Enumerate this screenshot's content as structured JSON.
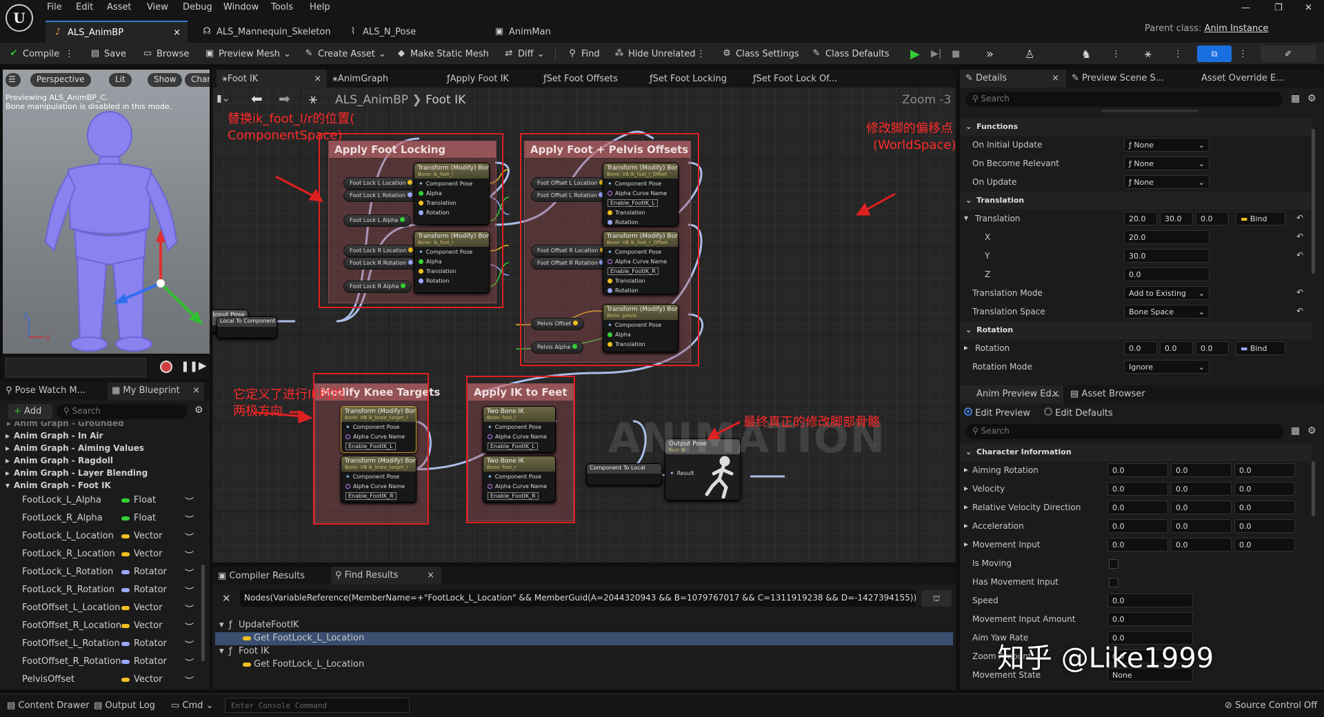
{
  "menu": [
    "File",
    "Edit",
    "Asset",
    "View",
    "Debug",
    "Window",
    "Tools",
    "Help"
  ],
  "tabs": [
    "ALS_AnimBP",
    "ALS_Mannequin_Skeleton",
    "ALS_N_Pose",
    "AnimMan"
  ],
  "parent_class": {
    "label": "Parent class:",
    "value": "Anim Instance"
  },
  "toolbar": {
    "compile": "Compile",
    "save": "Save",
    "browse": "Browse",
    "preview_mesh": "Preview Mesh",
    "create_asset": "Create Asset",
    "make_static_mesh": "Make Static Mesh",
    "diff": "Diff",
    "find": "Find",
    "hide_unrelated": "Hide Unrelated",
    "class_settings": "Class Settings",
    "class_defaults": "Class Defaults"
  },
  "viewport": {
    "perspective": "Perspective",
    "lit": "Lit",
    "show": "Show",
    "chara": "Chara",
    "msg1": "Previewing ALS_AnimBP_C.",
    "msg2": "Bone manipulation is disabled in this mode."
  },
  "graph": {
    "tabs": [
      "Foot IK",
      "AnimGraph",
      "Apply Foot IK",
      "Set Foot Offsets",
      "Set Foot Locking",
      "Set Foot Lock Of..."
    ],
    "breadcrumb": {
      "root": "ALS_AnimBP",
      "child": "Foot IK"
    },
    "zoom": "Zoom -3",
    "watermark": "ANIMATION",
    "comments": {
      "apply_foot_locking": "Apply Foot Locking",
      "apply_foot_pelvis": "Apply Foot + Pelvis Offsets",
      "modify_knee": "Modify Knee Targets",
      "apply_ik_feet": "Apply IK to Feet"
    },
    "annotations": {
      "a1_line1": "替换ik_foot_l/r的位置(",
      "a1_line2": "ComponentSpace)",
      "a2_line1": "修改脚的偏移点",
      "a2_line2": "(WorldSpace)",
      "a3_line1": "它定义了进行IK时的",
      "a3_line2": "两极方向",
      "a4": "最终真正的修改脚部骨骼"
    },
    "nodes": {
      "transform_title": "Transform (Modify) Bone",
      "two_bone_title": "Two Bone IK",
      "component_pose": "Component Pose",
      "alpha": "Alpha",
      "translation": "Translation",
      "rotation": "Rotation",
      "alpha_curve": "Alpha Curve Name",
      "bone_foot_l": "Bone: ik_foot_l",
      "bone_foot_r": "Bone: ik_foot_r",
      "bone_vb_foot_l": "Bone: VB ik_foot_l_Offset",
      "bone_vb_foot_r": "Bone: VB ik_foot_r_Offset",
      "bone_pelvis": "Bone: pelvis",
      "bone_vb_knee_l": "Bone: VB ik_knee_target_l",
      "bone_vb_knee_r": "Bone: VB ik_knee_target_r",
      "bone_foot_l2": "Bone: foot_l",
      "bone_foot_r2": "Bone: foot_r",
      "enable_l": "Enable_FootIK_L",
      "enable_r": "Enable_FootIK_R",
      "input_pose": "Input Pose",
      "local_to_component": "Local To Component",
      "component_to_local": "Component To Local",
      "output_pose": "Output Pose",
      "output_pose_sub": "Foot IK",
      "result": "Result"
    },
    "vars": {
      "fl_l_loc": "Foot Lock L Location",
      "fl_l_rot": "Foot Lock L Rotation",
      "fl_l_alpha": "Foot Lock L Alpha",
      "fl_r_loc": "Foot Lock R Location",
      "fl_r_rot": "Foot Lock R Rotation",
      "fl_r_alpha": "Foot Lock R Alpha",
      "fo_l_loc": "Foot Offset L Location",
      "fo_l_rot": "Foot Offset L Rotation",
      "fo_r_loc": "Foot Offset R Location",
      "fo_r_rot": "Foot Offset R Rotation",
      "pelvis_offset": "Pelvis Offset",
      "pelvis_alpha": "Pelvis Alpha"
    }
  },
  "left_panel": {
    "tabs": [
      "Pose Watch M...",
      "My Blueprint"
    ],
    "add": "Add",
    "search": "Search",
    "cut_row": "Anim Graph - Grounded",
    "groups": [
      "Anim Graph - In Air",
      "Anim Graph - Aiming Values",
      "Anim Graph - Ragdoll",
      "Anim Graph - Layer Blending",
      "Anim Graph - Foot IK"
    ],
    "variables": [
      {
        "name": "FootLock_L_Alpha",
        "type": "Float",
        "color": "#35d035"
      },
      {
        "name": "FootLock_R_Alpha",
        "type": "Float",
        "color": "#35d035"
      },
      {
        "name": "FootLock_L_Location",
        "type": "Vector",
        "color": "#f0c020"
      },
      {
        "name": "FootLock_R_Location",
        "type": "Vector",
        "color": "#f0c020"
      },
      {
        "name": "FootLock_L_Rotation",
        "type": "Rotator",
        "color": "#9aa8ff"
      },
      {
        "name": "FootLock_R_Rotation",
        "type": "Rotator",
        "color": "#9aa8ff"
      },
      {
        "name": "FootOffset_L_Location",
        "type": "Vector",
        "color": "#f0c020"
      },
      {
        "name": "FootOffset_R_Location",
        "type": "Vector",
        "color": "#f0c020"
      },
      {
        "name": "FootOffset_L_Rotation",
        "type": "Rotator",
        "color": "#9aa8ff"
      },
      {
        "name": "FootOffset_R_Rotation",
        "type": "Rotator",
        "color": "#9aa8ff"
      },
      {
        "name": "PelvisOffset",
        "type": "Vector",
        "color": "#f0c020"
      }
    ]
  },
  "results": {
    "tabs": [
      "Compiler Results",
      "Find Results"
    ],
    "query": "Nodes(VariableReference(MemberName=+\"FootLock_L_Location\" && MemberGuid(A=2044320943 && B=1079767017 && C=1311919238 && D=-1427394155)) || Name=\"",
    "tree": [
      {
        "text": "UpdateFootIK",
        "level": 0
      },
      {
        "text": "Get FootLock_L_Location",
        "level": 1,
        "selected": true
      },
      {
        "text": "Foot IK",
        "level": 0
      },
      {
        "text": "Get FootLock_L_Location",
        "level": 1,
        "selected": false
      }
    ]
  },
  "details": {
    "tabs": [
      "Details",
      "Preview Scene S...",
      "Asset Override E..."
    ],
    "search": "Search",
    "functions_header": "Functions",
    "functions": [
      {
        "label": "On Initial Update",
        "value": "None"
      },
      {
        "label": "On Become Relevant",
        "value": "None"
      },
      {
        "label": "On Update",
        "value": "None"
      }
    ],
    "translation_header": "Translation",
    "translation": {
      "label": "Translation",
      "x": "20.0",
      "y": "30.0",
      "z": "0.0",
      "bind": "Bind",
      "x_label": "X",
      "y_label": "Y",
      "z_label": "Z"
    },
    "translation_mode": {
      "label": "Translation Mode",
      "value": "Add to Existing"
    },
    "translation_space": {
      "label": "Translation Space",
      "value": "Bone Space"
    },
    "rotation_header": "Rotation",
    "rotation": {
      "label": "Rotation",
      "x": "0.0",
      "y": "0.0",
      "z": "0.0",
      "bind": "Bind"
    },
    "rotation_mode": {
      "label": "Rotation Mode",
      "value": "Ignore"
    }
  },
  "anim_preview": {
    "tabs": [
      "Anim Preview Ed...",
      "Asset Browser"
    ],
    "radio": [
      "Edit Preview",
      "Edit Defaults"
    ],
    "search": "Search",
    "section": "Character Information",
    "rows": [
      {
        "label": "Aiming Rotation",
        "vals": [
          "0.0",
          "0.0",
          "0.0"
        ],
        "expand": true
      },
      {
        "label": "Velocity",
        "vals": [
          "0.0",
          "0.0",
          "0.0"
        ],
        "expand": true
      },
      {
        "label": "Relative Velocity Direction",
        "vals": [
          "0.0",
          "0.0",
          "0.0"
        ],
        "expand": true
      },
      {
        "label": "Acceleration",
        "vals": [
          "0.0",
          "0.0",
          "0.0"
        ],
        "expand": true
      },
      {
        "label": "Movement Input",
        "vals": [
          "0.0",
          "0.0",
          "0.0"
        ],
        "expand": true
      },
      {
        "label": "Is Moving",
        "check": true
      },
      {
        "label": "Has Movement Input",
        "check": true
      },
      {
        "label": "Speed",
        "vals": [
          "0.0"
        ]
      },
      {
        "label": "Movement Input Amount",
        "vals": [
          "0.0"
        ]
      },
      {
        "label": "Aim Yaw Rate",
        "vals": [
          "0.0"
        ]
      },
      {
        "label": "Zoom Amount",
        "vals": [
          "0.0"
        ]
      },
      {
        "label": "Movement State",
        "vals": [
          "None"
        ]
      }
    ]
  },
  "watermark": "知乎 @Like1999",
  "status": {
    "content_drawer": "Content Drawer",
    "output_log": "Output Log",
    "cmd": "Cmd",
    "console_placeholder": "Enter Console Command",
    "source_control": "Source Control Off"
  }
}
